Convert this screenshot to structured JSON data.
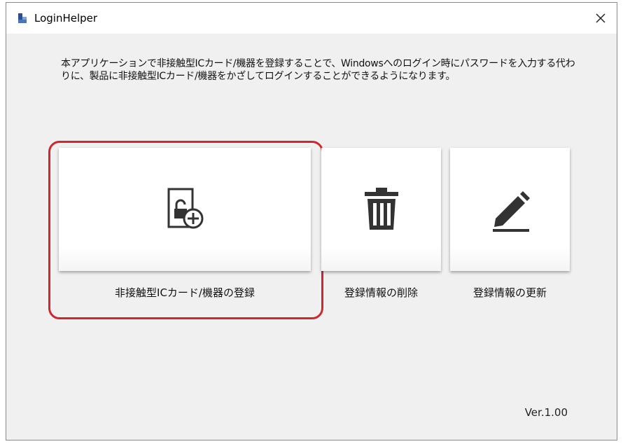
{
  "window": {
    "title": "LoginHelper",
    "app_icon": "app-icon",
    "close_icon": "close-icon"
  },
  "description": "本アプリケーションで非接触型ICカード/機器を登録することで、Windowsへのログイン時にパスワードを入力する代わりに、製品に非接触型ICカード/機器をかざしてログインすることができるようになります。",
  "actions": [
    {
      "label": "非接触型ICカード/機器の登録",
      "icon": "card-lock-add-icon",
      "highlighted": true
    },
    {
      "label": "登録情報の削除",
      "icon": "trash-icon",
      "highlighted": false
    },
    {
      "label": "登録情報の更新",
      "icon": "pencil-icon",
      "highlighted": false
    }
  ],
  "version": "Ver.1.00",
  "colors": {
    "highlight": "#d0262f",
    "icon": "#333333",
    "background": "#f0f0f0"
  }
}
